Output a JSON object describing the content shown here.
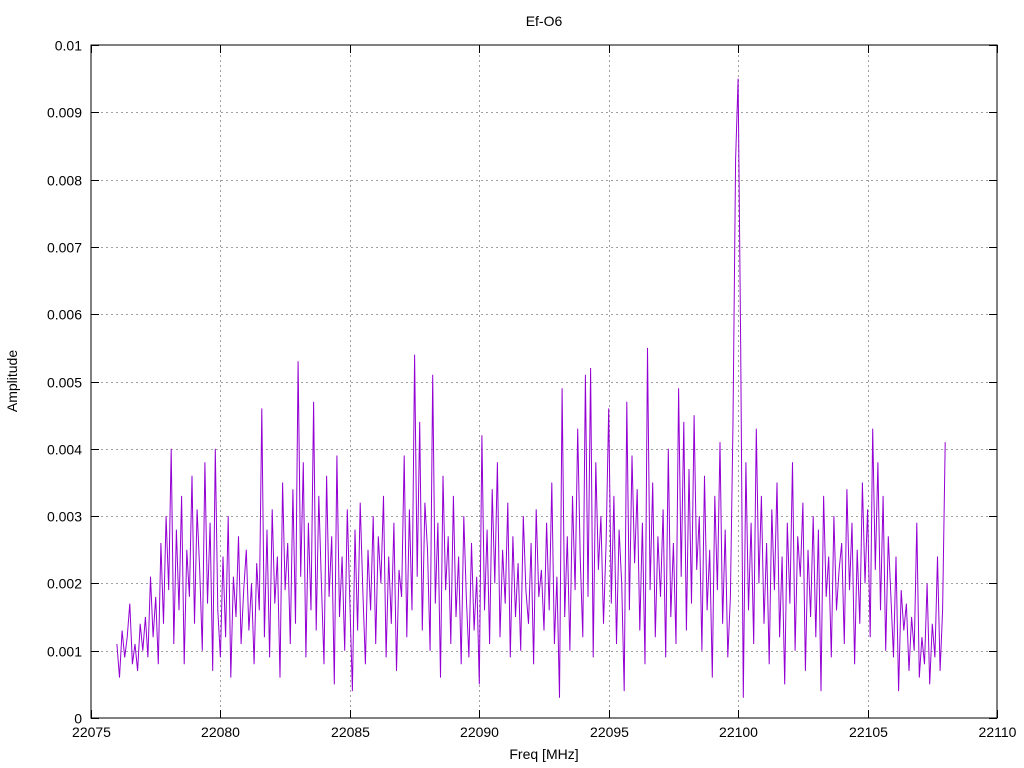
{
  "chart_data": {
    "type": "line",
    "title": "Ef-O6",
    "xlabel": "Freq [MHz]",
    "ylabel": "Amplitude",
    "xlim": [
      22075,
      22110
    ],
    "ylim": [
      0,
      0.01
    ],
    "grid": true,
    "x_ticks": [
      22075,
      22080,
      22085,
      22090,
      22095,
      22100,
      22105,
      22110
    ],
    "x_tick_labels": [
      "22075",
      "22080",
      "22085",
      "22090",
      "22095",
      "22100",
      "22105",
      "22110"
    ],
    "y_ticks": [
      0,
      0.001,
      0.002,
      0.003,
      0.004,
      0.005,
      0.006,
      0.007,
      0.008,
      0.009,
      0.01
    ],
    "y_tick_labels": [
      "0",
      "0.001",
      "0.002",
      "0.003",
      "0.004",
      "0.005",
      "0.006",
      "0.007",
      "0.008",
      "0.009",
      "0.01"
    ],
    "series": [
      {
        "name": "Ef-O6",
        "color": "#9400d3",
        "x_start": 22076.0,
        "x_step": 0.1,
        "values": [
          0.0011,
          0.0006,
          0.0013,
          0.0009,
          0.0012,
          0.0017,
          0.0008,
          0.0011,
          0.0007,
          0.0014,
          0.001,
          0.0015,
          0.0009,
          0.0021,
          0.0012,
          0.0018,
          0.0008,
          0.0026,
          0.0014,
          0.003,
          0.0019,
          0.004,
          0.0011,
          0.0028,
          0.0016,
          0.0033,
          0.0008,
          0.0025,
          0.0018,
          0.0036,
          0.0014,
          0.0031,
          0.0022,
          0.001,
          0.0038,
          0.0017,
          0.0029,
          0.0007,
          0.004,
          0.0016,
          0.0009,
          0.0024,
          0.0012,
          0.003,
          0.0006,
          0.0021,
          0.0015,
          0.0027,
          0.0011,
          0.0019,
          0.0025,
          0.0013,
          0.002,
          0.0008,
          0.0023,
          0.0016,
          0.0046,
          0.0012,
          0.0028,
          0.0009,
          0.0031,
          0.0017,
          0.0024,
          0.0006,
          0.0035,
          0.0019,
          0.0026,
          0.0011,
          0.0034,
          0.0014,
          0.0053,
          0.0021,
          0.0038,
          0.0009,
          0.0029,
          0.0016,
          0.0047,
          0.0013,
          0.0033,
          0.002,
          0.0008,
          0.0036,
          0.0018,
          0.0027,
          0.0005,
          0.0039,
          0.0015,
          0.0024,
          0.001,
          0.0031,
          0.0017,
          0.0004,
          0.0028,
          0.0013,
          0.0032,
          0.0019,
          0.0008,
          0.0025,
          0.0016,
          0.003,
          0.0011,
          0.0027,
          0.002,
          0.0033,
          0.0009,
          0.0024,
          0.0014,
          0.0029,
          0.0007,
          0.0022,
          0.0018,
          0.0039,
          0.0012,
          0.0031,
          0.0016,
          0.0054,
          0.0021,
          0.0044,
          0.0013,
          0.0032,
          0.0025,
          0.001,
          0.0051,
          0.0017,
          0.0029,
          0.0006,
          0.0036,
          0.0019,
          0.0027,
          0.0011,
          0.0033,
          0.0015,
          0.0024,
          0.0008,
          0.003,
          0.0018,
          0.0009,
          0.0026,
          0.0013,
          0.0021,
          0.0005,
          0.0042,
          0.0016,
          0.0028,
          0.0011,
          0.0034,
          0.002,
          0.0038,
          0.0012,
          0.0025,
          0.0017,
          0.0032,
          0.0009,
          0.0027,
          0.0015,
          0.0023,
          0.001,
          0.003,
          0.0019,
          0.0014,
          0.0026,
          0.0008,
          0.0031,
          0.0018,
          0.0022,
          0.0013,
          0.0029,
          0.0016,
          0.0035,
          0.0011,
          0.0021,
          0.0003,
          0.0049,
          0.0015,
          0.0027,
          0.001,
          0.0033,
          0.0019,
          0.0043,
          0.0024,
          0.0012,
          0.0051,
          0.0018,
          0.0052,
          0.0009,
          0.0038,
          0.0022,
          0.003,
          0.0014,
          0.0026,
          0.0046,
          0.0017,
          0.0033,
          0.0011,
          0.0028,
          0.002,
          0.0004,
          0.0047,
          0.0016,
          0.0039,
          0.0023,
          0.0034,
          0.0013,
          0.0029,
          0.0008,
          0.0055,
          0.0019,
          0.0035,
          0.0012,
          0.0027,
          0.0018,
          0.0031,
          0.0009,
          0.004,
          0.0015,
          0.0026,
          0.0011,
          0.0049,
          0.0021,
          0.0044,
          0.0013,
          0.0037,
          0.0017,
          0.0045,
          0.0022,
          0.003,
          0.001,
          0.0036,
          0.0016,
          0.0025,
          0.0006,
          0.0033,
          0.0019,
          0.0041,
          0.0014,
          0.0028,
          0.0009,
          0.0018,
          0.0044,
          0.0083,
          0.0095,
          0.0055,
          0.0003,
          0.0038,
          0.0016,
          0.0029,
          0.0011,
          0.0043,
          0.002,
          0.0033,
          0.0014,
          0.0026,
          0.0008,
          0.0031,
          0.0019,
          0.0035,
          0.0012,
          0.0024,
          0.0005,
          0.0029,
          0.0017,
          0.0038,
          0.001,
          0.0027,
          0.0021,
          0.0032,
          0.0007,
          0.0025,
          0.0015,
          0.003,
          0.0012,
          0.0028,
          0.0004,
          0.0033,
          0.0018,
          0.0024,
          0.0009,
          0.003,
          0.0016,
          0.0022,
          0.0026,
          0.0011,
          0.0034,
          0.0019,
          0.0029,
          0.0008,
          0.0025,
          0.0014,
          0.0035,
          0.002,
          0.0031,
          0.0012,
          0.0043,
          0.0022,
          0.0038,
          0.0016,
          0.0033,
          0.001,
          0.0027,
          0.0018,
          0.0009,
          0.0024,
          0.0004,
          0.0019,
          0.0013,
          0.0017,
          0.0007,
          0.0015,
          0.001,
          0.0029,
          0.0006,
          0.0012,
          0.0008,
          0.002,
          0.0005,
          0.0014,
          0.0009,
          0.0024,
          0.0007,
          0.0016,
          0.0041
        ]
      }
    ]
  }
}
